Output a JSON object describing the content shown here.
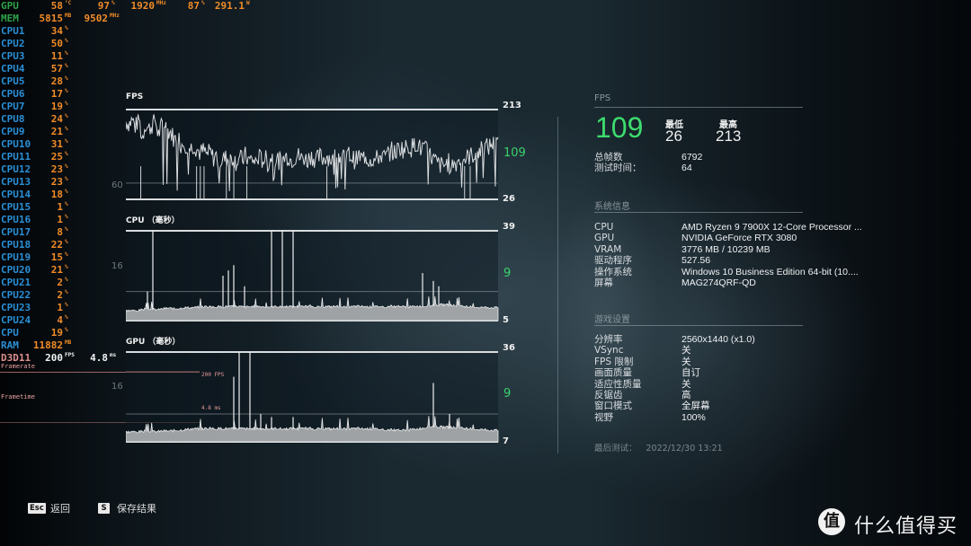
{
  "osd": {
    "gpu": {
      "label": "GPU",
      "temp": "58",
      "temp_unit": "°C",
      "load": "97",
      "load_unit": "%",
      "clock": "1920",
      "clock_unit": "MHz",
      "fan": "87",
      "fan_unit": "%",
      "power": "291.1",
      "power_unit": "W"
    },
    "mem": {
      "label": "MEM",
      "used": "5815",
      "used_unit": "MB",
      "clock": "9502",
      "clock_unit": "MHz"
    },
    "cpus": [
      {
        "label": "CPU1",
        "value": "34"
      },
      {
        "label": "CPU2",
        "value": "50"
      },
      {
        "label": "CPU3",
        "value": "11"
      },
      {
        "label": "CPU4",
        "value": "57"
      },
      {
        "label": "CPU5",
        "value": "28"
      },
      {
        "label": "CPU6",
        "value": "17"
      },
      {
        "label": "CPU7",
        "value": "19"
      },
      {
        "label": "CPU8",
        "value": "24"
      },
      {
        "label": "CPU9",
        "value": "21"
      },
      {
        "label": "CPU10",
        "value": "31"
      },
      {
        "label": "CPU11",
        "value": "25"
      },
      {
        "label": "CPU12",
        "value": "23"
      },
      {
        "label": "CPU13",
        "value": "23"
      },
      {
        "label": "CPU14",
        "value": "18"
      },
      {
        "label": "CPU15",
        "value": "1"
      },
      {
        "label": "CPU16",
        "value": "1"
      },
      {
        "label": "CPU17",
        "value": "8"
      },
      {
        "label": "CPU18",
        "value": "22"
      },
      {
        "label": "CPU19",
        "value": "15"
      },
      {
        "label": "CPU20",
        "value": "21"
      },
      {
        "label": "CPU21",
        "value": "2"
      },
      {
        "label": "CPU22",
        "value": "2"
      },
      {
        "label": "CPU23",
        "value": "1"
      },
      {
        "label": "CPU24",
        "value": "4"
      }
    ],
    "cpu_total": {
      "label": "CPU",
      "value": "19"
    },
    "cpu_unit": "%",
    "ram": {
      "label": "RAM",
      "value": "11882",
      "unit": "MB"
    },
    "d3d": {
      "label": "D3D11",
      "fps": "200",
      "fps_unit": "FPS",
      "frametime": "4.8",
      "frametime_unit": "ms"
    },
    "framerate_label": "Framerate",
    "frametime_label": "Frametime",
    "overlay_fps": "200 FPS",
    "overlay_ms": "4.8 ms"
  },
  "charts": {
    "fps": {
      "title": "FPS",
      "max": "213",
      "min": "26",
      "current": "109",
      "grid": "60"
    },
    "cpu": {
      "title": "CPU （毫秒）",
      "max": "39",
      "min": "5",
      "current": "9",
      "grid": "16"
    },
    "gpu": {
      "title": "GPU （毫秒）",
      "max": "36",
      "min": "7",
      "current": "9",
      "grid": "16"
    }
  },
  "chart_data": [
    {
      "type": "line",
      "title": "FPS",
      "ylim": [
        26,
        213
      ],
      "gridlines": [
        60
      ],
      "current": 109,
      "samples_note": "approx. trace sampled across benchmark run",
      "series": [
        {
          "name": "FPS",
          "values": [
            188,
            184,
            192,
            176,
            198,
            150,
            185,
            172,
            180,
            195,
            160,
            178,
            182,
            170,
            165,
            150,
            160,
            140,
            145,
            138,
            132,
            140,
            130,
            122,
            128,
            118,
            125,
            112,
            118,
            105,
            110,
            112,
            108,
            115,
            104,
            112,
            108,
            118,
            106,
            110,
            102,
            114,
            108,
            112,
            100,
            116,
            110,
            108,
            105,
            112,
            118,
            108,
            112,
            120,
            110,
            114,
            106,
            118,
            112,
            108,
            116,
            110,
            118,
            112,
            106,
            122,
            118,
            110,
            114,
            120,
            112,
            106,
            116,
            110,
            118,
            108,
            112,
            106,
            114,
            118,
            112,
            120,
            128,
            122,
            130,
            135,
            128,
            140,
            132,
            138,
            145,
            130,
            135,
            125,
            118,
            110,
            102,
            98,
            95,
            100,
            104,
            98,
            102,
            108,
            112,
            110,
            116,
            118,
            122,
            126,
            130,
            136,
            134,
            142,
            140,
            138
          ]
        }
      ]
    },
    {
      "type": "area",
      "title": "CPU （毫秒）",
      "ylim": [
        5,
        39
      ],
      "gridlines": [
        16
      ],
      "current": 9,
      "series": [
        {
          "name": "CPU ms",
          "values": [
            8.6,
            8.7,
            8.5,
            9.0,
            9.3,
            9.1,
            9.0,
            9.4,
            9.6,
            9.3,
            9.5,
            9.8,
            9.7,
            9.9,
            10.0,
            10.2,
            9.9,
            10.1,
            10.0,
            10.3,
            10.1,
            10.2,
            10.0,
            10.1,
            10.3,
            10.2,
            10.0,
            10.1,
            10.2,
            10.0,
            10.3,
            10.1,
            10.2,
            10.0,
            10.4,
            10.1,
            10.0,
            10.2,
            10.1,
            10.3,
            10.2,
            10.0,
            10.1,
            10.3,
            10.2,
            10.0,
            10.1,
            10.2,
            10.0,
            10.3,
            10.1,
            10.2,
            10.0,
            10.1,
            10.3,
            10.2,
            10.4,
            10.6,
            10.8,
            10.9,
            10.7,
            10.5,
            10.3,
            10.2,
            10.0,
            9.9,
            9.8,
            9.9,
            9.7,
            9.8
          ]
        }
      ],
      "spikes": [
        [
          4,
          16
        ],
        [
          5,
          39
        ],
        [
          18,
          22
        ],
        [
          19,
          24
        ],
        [
          20,
          26
        ],
        [
          22,
          18
        ],
        [
          27,
          39
        ],
        [
          29,
          39
        ],
        [
          31,
          39
        ],
        [
          55,
          23
        ],
        [
          57,
          20
        ],
        [
          58,
          18
        ],
        [
          101,
          21
        ],
        [
          102,
          20
        ]
      ]
    },
    {
      "type": "area",
      "title": "GPU （毫秒）",
      "ylim": [
        7,
        36
      ],
      "gridlines": [
        16
      ],
      "current": 9,
      "series": [
        {
          "name": "GPU ms",
          "values": [
            10.0,
            10.1,
            10.0,
            10.2,
            10.3,
            10.1,
            10.2,
            10.4,
            10.3,
            10.5,
            10.6,
            10.8,
            11.0,
            11.1,
            11.0,
            11.2,
            11.1,
            11.0,
            11.2,
            11.1,
            11.0,
            11.2,
            11.1,
            11.0,
            11.2,
            11.1,
            11.0,
            11.1,
            11.2,
            11.0,
            11.1,
            11.2,
            11.0,
            11.1,
            11.2,
            11.0,
            11.1,
            11.2,
            11.0,
            11.1,
            11.2,
            11.0,
            11.1,
            11.2,
            11.0,
            11.1,
            11.0,
            10.9,
            10.8,
            10.7,
            10.6,
            10.5,
            10.6,
            10.8,
            11.0,
            11.3,
            11.6,
            11.8,
            11.7,
            11.6,
            11.5,
            11.4,
            11.3,
            11.2,
            11.0,
            10.9,
            10.8,
            10.7,
            10.6,
            10.5
          ]
        }
      ],
      "spikes": [
        [
          20,
          28
        ],
        [
          21,
          36
        ],
        [
          23,
          36
        ],
        [
          25,
          16
        ],
        [
          27,
          15
        ],
        [
          31,
          15
        ],
        [
          57,
          26
        ],
        [
          60,
          16
        ]
      ]
    }
  ],
  "summary": {
    "section_title": "FPS",
    "avg_fps": "109",
    "min_label": "最低",
    "min_value": "26",
    "max_label": "最高",
    "max_value": "213",
    "total_frames_label": "总帧数",
    "total_frames_value": "6792",
    "duration_label": "测试时间：",
    "duration_value": "64"
  },
  "system_info": {
    "section_title": "系统信息",
    "rows": [
      {
        "key": "CPU",
        "value": "AMD Ryzen 9 7900X 12-Core Processor  ..."
      },
      {
        "key": "GPU",
        "value": "NVIDIA GeForce RTX 3080"
      },
      {
        "key": "VRAM",
        "value": "3776 MB / 10239 MB"
      },
      {
        "key": "驱动程序",
        "value": "527.56"
      },
      {
        "key": "操作系统",
        "value": "Windows 10 Business Edition 64-bit (10...."
      },
      {
        "key": "屏幕",
        "value": "MAG274QRF-QD"
      }
    ]
  },
  "game_settings": {
    "section_title": "游戏设置",
    "rows": [
      {
        "key": "分辨率",
        "value": "2560x1440  (x1.0)"
      },
      {
        "key": "VSync",
        "value": "关"
      },
      {
        "key": "FPS 限制",
        "value": "关"
      },
      {
        "key": "画面质量",
        "value": "自订"
      },
      {
        "key": "适应性质量",
        "value": "关"
      },
      {
        "key": "反锯齿",
        "value": "高"
      },
      {
        "key": "窗口模式",
        "value": "全屏幕"
      },
      {
        "key": "视野",
        "value": "100%"
      }
    ]
  },
  "last_test": {
    "label": "最后测试：",
    "value": "2022/12/30 13:21"
  },
  "footer": {
    "back_key": "Esc",
    "back_label": "返回",
    "save_key": "S",
    "save_label": "保存结果"
  },
  "watermark": {
    "icon_char": "值",
    "text": "什么值得买"
  },
  "colors": {
    "accent_green": "#3ddc6e",
    "osd_orange": "#f28c28",
    "osd_blue": "#2a8fd6",
    "osd_green": "#2fa34a"
  }
}
